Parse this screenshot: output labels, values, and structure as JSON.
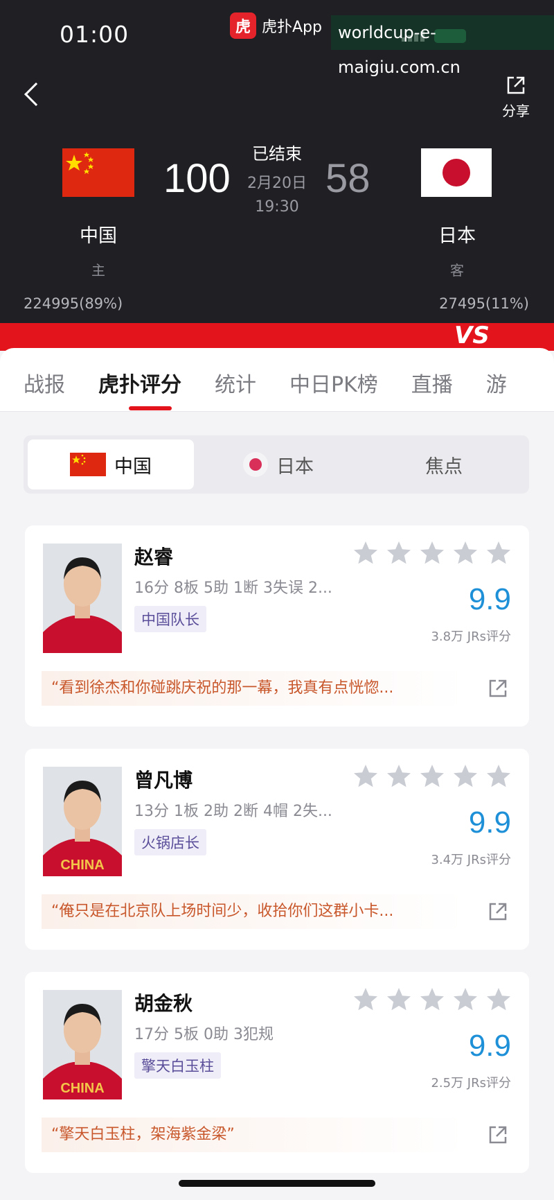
{
  "status_bar": {
    "time": "01:00",
    "app_logo": "虎",
    "app_name": "虎扑App",
    "watermark": "worldcup-e-maigiu.com.cn"
  },
  "header": {
    "share_label": "分享",
    "match_status": "已结束",
    "date": "2月20日",
    "time": "19:30",
    "home": {
      "name": "中国",
      "role": "主",
      "score": "100",
      "support": "224995(89%)"
    },
    "away": {
      "name": "日本",
      "role": "客",
      "score": "58",
      "support": "27495(11%)"
    },
    "vs": "VS"
  },
  "tabs": [
    {
      "label": "战报",
      "active": false
    },
    {
      "label": "虎扑评分",
      "active": true
    },
    {
      "label": "统计",
      "active": false
    },
    {
      "label": "中日PK榜",
      "active": false
    },
    {
      "label": "直播",
      "active": false
    },
    {
      "label": "游",
      "active": false
    }
  ],
  "team_selector": [
    {
      "label": "中国",
      "active": true
    },
    {
      "label": "日本",
      "active": false
    },
    {
      "label": "焦点",
      "active": false
    }
  ],
  "players": [
    {
      "name": "赵睿",
      "stats": "16分 8板 5助 1断 3失误 2...",
      "tag": "中国队长",
      "rating": "9.9",
      "count": "3.8万 JRs评分",
      "quote": "“看到徐杰和你碰跳庆祝的那一幕，我真有点恍惚...",
      "jersey": ""
    },
    {
      "name": "曾凡博",
      "stats": "13分 1板 2助 2断 4帽 2失...",
      "tag": "火锅店长",
      "rating": "9.9",
      "count": "3.4万 JRs评分",
      "quote": "“俺只是在北京队上场时间少，收拾你们这群小卡...",
      "jersey": "CHINA"
    },
    {
      "name": "胡金秋",
      "stats": "17分 5板 0助 3犯规",
      "tag": "擎天白玉柱",
      "rating": "9.9",
      "count": "2.5万 JRs评分",
      "quote": "“擎天白玉柱，架海紫金梁”",
      "jersey": "CHINA"
    }
  ],
  "colors": {
    "brand_red": "#e4141c",
    "rating_blue": "#1e90d8",
    "quote_orange": "#c8572b",
    "star_gray": "#c9ccd3"
  },
  "icons": [
    "back-arrow-icon",
    "share-icon",
    "star-icon",
    "open-external-icon"
  ]
}
